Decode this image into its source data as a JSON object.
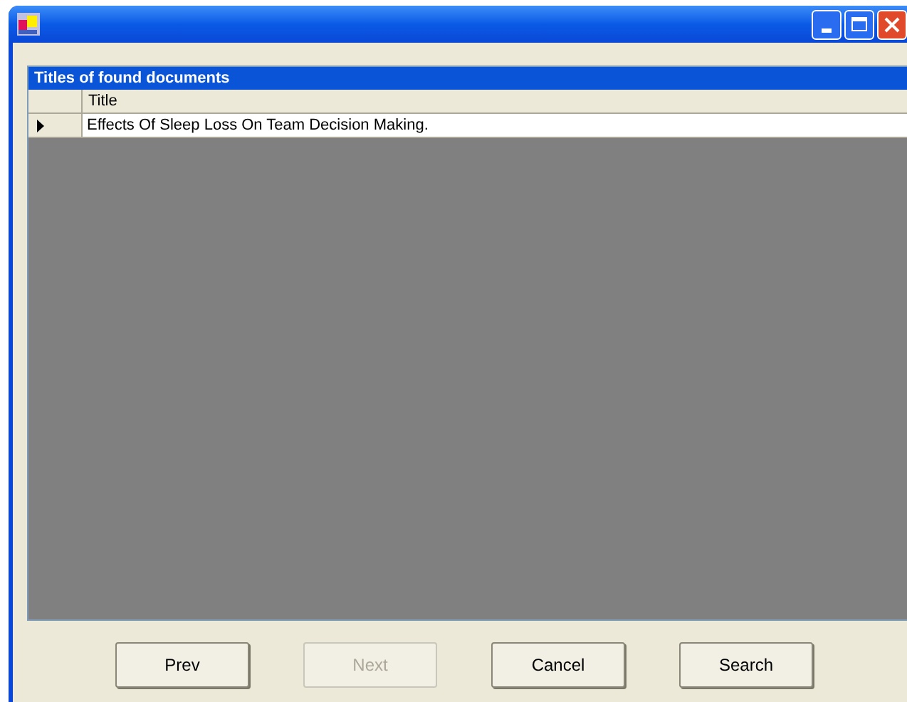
{
  "grid": {
    "caption": "Titles of found documents",
    "columns": [
      "Title"
    ],
    "rows": [
      {
        "cells": [
          "Effects Of Sleep Loss On Team Decision Making."
        ],
        "current": true
      }
    ]
  },
  "buttons": [
    {
      "label": "Prev",
      "disabled": false
    },
    {
      "label": "Next",
      "disabled": true
    },
    {
      "label": "Cancel",
      "disabled": false
    },
    {
      "label": "Search",
      "disabled": false
    }
  ]
}
